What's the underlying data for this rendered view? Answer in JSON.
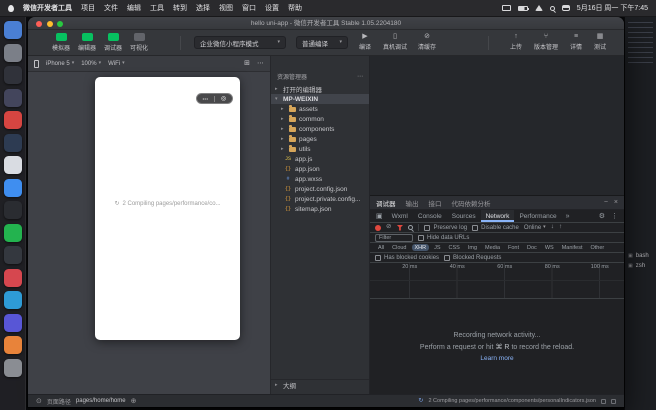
{
  "colors": {
    "wechat_green": "#07c160",
    "record_red": "#e0483e",
    "link_blue": "#8ab4f8",
    "folder_yellow": "#d7a65a"
  },
  "icons": {
    "chevron_right": "▸",
    "chevron_down": "▾",
    "caret": "▾",
    "ellipsis": "⋯",
    "close": "×",
    "minimize": "−",
    "gear": "⚙",
    "more_vert": "⋮",
    "overflow": "»",
    "inspect": "▣",
    "clear": "⊘",
    "arrow_down": "↓",
    "arrow_up": "↑",
    "spinner": "↻",
    "plus": "⊕",
    "page": "⊙",
    "dots": "•••",
    "target": "◎",
    "grid": "⊞",
    "play": "▶",
    "upload": "↑",
    "branch": "⑂",
    "info": "≡",
    "test": "▦",
    "phone": "▯",
    "cache": "⊘",
    "terminal": "▣"
  },
  "menubar": {
    "app_name": "微信开发者工具",
    "menus": [
      "项目",
      "文件",
      "编辑",
      "工具",
      "转到",
      "选择",
      "视图",
      "窗口",
      "设置",
      "帮助"
    ],
    "clock": "5月16日 周一 下午7:45"
  },
  "dock": {
    "apps": [
      {
        "name": "app1",
        "bg": "#4a7fd4"
      },
      {
        "name": "app2",
        "bg": "#7b7f88"
      },
      {
        "name": "app3",
        "bg": "#30323a"
      },
      {
        "name": "app4",
        "bg": "#43455c"
      },
      {
        "name": "app5",
        "bg": "#d64541"
      },
      {
        "name": "app6",
        "bg": "#2d3b52"
      },
      {
        "name": "app7",
        "bg": "#d9dce2"
      },
      {
        "name": "app8",
        "bg": "#3f8ef0"
      },
      {
        "name": "app9",
        "bg": "#2a2c31"
      },
      {
        "name": "app10",
        "bg": "#23b34f"
      },
      {
        "name": "app11",
        "bg": "#34383f"
      },
      {
        "name": "app12",
        "bg": "#d6474f"
      },
      {
        "name": "app13",
        "bg": "#2e9bd6"
      },
      {
        "name": "app14",
        "bg": "#5856d6"
      },
      {
        "name": "app15",
        "bg": "#e8833a"
      },
      {
        "name": "app16",
        "bg": "#8a8d93"
      }
    ]
  },
  "window": {
    "title": "hello uni-app - 微信开发者工具 Stable 1.05.2204180",
    "toolbar": {
      "panels": [
        {
          "label": "模拟器"
        },
        {
          "label": "编辑器"
        },
        {
          "label": "调试器"
        },
        {
          "label": "可视化"
        }
      ],
      "mode_dropdown": "企业微信小程序模式",
      "compile_dropdown": "普通编译",
      "compile": "编译",
      "device_debug": "真机调试",
      "clear_cache": "清缓存",
      "upload": "上传",
      "version_control": "版本管理",
      "details": "详情",
      "test": "测试"
    },
    "simulator": {
      "device": "iPhone 5",
      "zoom": "100%",
      "network": "WiFi",
      "compiling_text": "2 Compiling pages/performance/co..."
    },
    "explorer": {
      "title": "资源管理器",
      "open_editors": "打开的编辑器",
      "root": "MP-WEIXIN",
      "folders": [
        "assets",
        "common",
        "components",
        "pages",
        "utils"
      ],
      "files": [
        {
          "label": "app.js",
          "glyph": "JS",
          "color": "#e8c94d"
        },
        {
          "label": "app.json",
          "glyph": "{}",
          "color": "#e8a33d"
        },
        {
          "label": "app.wxss",
          "glyph": "#",
          "color": "#6a9ae8"
        },
        {
          "label": "project.config.json",
          "glyph": "{}",
          "color": "#e8a33d"
        },
        {
          "label": "project.private.config...",
          "glyph": "{}",
          "color": "#e8a33d"
        },
        {
          "label": "sitemap.json",
          "glyph": "{}",
          "color": "#e8a33d"
        }
      ],
      "outline": "大纲"
    },
    "debugger": {
      "tabs": [
        {
          "label": "调试器",
          "active": true
        },
        {
          "label": "输出"
        },
        {
          "label": "接口"
        },
        {
          "label": "代码依赖分析"
        }
      ],
      "devtools_tabs": [
        {
          "label": "Wxml"
        },
        {
          "label": "Console"
        },
        {
          "label": "Sources"
        },
        {
          "label": "Network",
          "active": true
        },
        {
          "label": "Performance"
        }
      ],
      "network": {
        "preserve_log": "Preserve log",
        "disable_cache": "Disable cache",
        "throttle": "Online",
        "filter_placeholder": "Filter",
        "hide_data_urls": "Hide data URLs",
        "filters": [
          {
            "label": "All"
          },
          {
            "label": "Cloud"
          },
          {
            "label": "XHR",
            "active": true
          },
          {
            "label": "JS"
          },
          {
            "label": "CSS"
          },
          {
            "label": "Img"
          },
          {
            "label": "Media"
          },
          {
            "label": "Font"
          },
          {
            "label": "Doc"
          },
          {
            "label": "WS"
          },
          {
            "label": "Manifest"
          },
          {
            "label": "Other"
          }
        ],
        "has_blocked_cookies": "Has blocked cookies",
        "blocked_requests": "Blocked Requests",
        "timeline_ticks": [
          "20 ms",
          "40 ms",
          "60 ms",
          "80 ms",
          "100 ms"
        ],
        "empty_title": "Recording network activity...",
        "empty_hint_pre": "Perform a request or hit",
        "empty_hint_keys": "⌘ R",
        "empty_hint_post": "to record the reload.",
        "learn_more": "Learn more"
      }
    },
    "statusbar": {
      "page_path_label": "页面路径",
      "page_path": "pages/home/home",
      "compile_status": "2 Compiling pages/performance/components/personalIndicators.json"
    }
  },
  "side_panel": {
    "terminals": [
      "bash",
      "zsh"
    ]
  }
}
